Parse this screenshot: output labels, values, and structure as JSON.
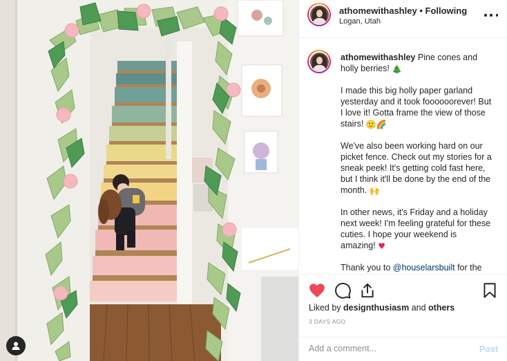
{
  "post": {
    "username": "athomewithashley",
    "separator": "•",
    "follow_status": "Following",
    "location": "Logan, Utah"
  },
  "caption": {
    "username": "athomewithashley",
    "line1": "Pine cones and holly berries!",
    "line1_emoji": "🎄",
    "para2": "I made this big holly paper garland yesterday and it took foooooorever! But I love it! Gotta frame the view of those stairs!",
    "para2_emoji": "🙂🌈",
    "para3": "We've also been working hard on our picket fence. Check out my stories for a sneak peek! It's getting cold fast here, but I think it'll be done by the end of the month.",
    "para3_emoji": "🙌",
    "para4": "In other news, it's Friday and a holiday next week! I'm feeling grateful for these cuties. I hope your weekend is amazing!",
    "para4_emoji": "♥",
    "para5_prefix": "Thank you to",
    "para5_mention": "@houselarsbuilt",
    "para5_suffix": "for the"
  },
  "engagement": {
    "liked_by_prefix": "Liked by",
    "liked_by_user": "designthusiasm",
    "liked_by_and": "and",
    "liked_by_others": "others",
    "timestamp": "3 DAYS AGO"
  },
  "comment": {
    "placeholder": "Add a comment...",
    "post_label": "Post"
  },
  "icons": {
    "like": "heart-icon",
    "comment": "comment-icon",
    "share": "share-icon",
    "save": "bookmark-icon",
    "more": "more-options-icon",
    "user_tag": "user-tag-icon"
  },
  "colors": {
    "like_red": "#ed4956",
    "mention_blue": "#00376b",
    "post_disabled": "#b3dbff",
    "muted": "#8e8e8e"
  }
}
